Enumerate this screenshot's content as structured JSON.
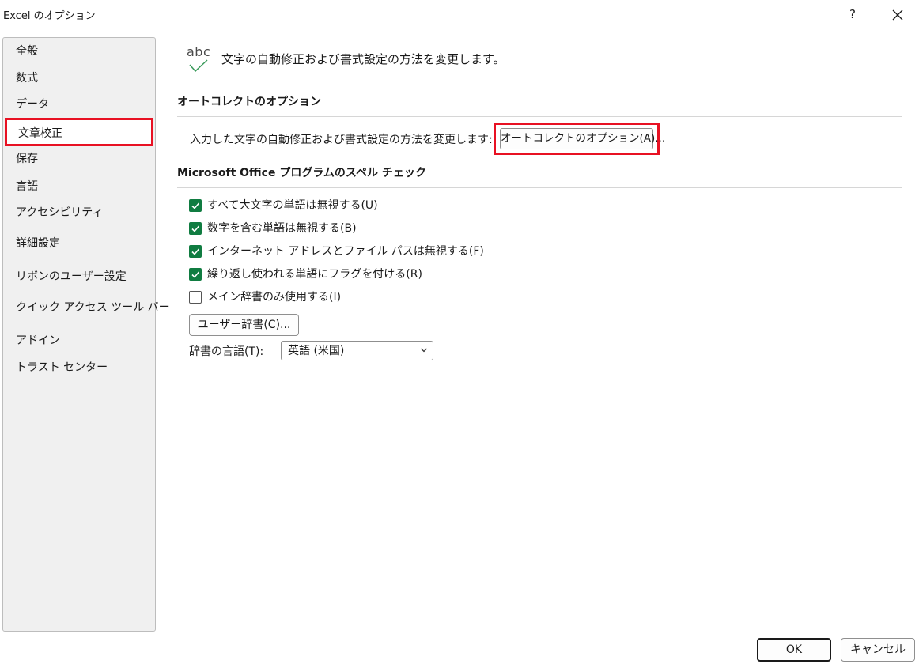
{
  "window": {
    "title": "Excel のオプション",
    "help_label": "?"
  },
  "sidebar": {
    "items": [
      {
        "label": "全般"
      },
      {
        "label": "数式"
      },
      {
        "label": "データ"
      },
      {
        "label": "文章校正",
        "selected": true
      },
      {
        "label": "保存"
      },
      {
        "label": "言語"
      },
      {
        "label": "アクセシビリティ"
      },
      {
        "label": "詳細設定"
      },
      {
        "label": "リボンのユーザー設定"
      },
      {
        "label": "クイック アクセス ツール バー"
      },
      {
        "label": "アドイン"
      },
      {
        "label": "トラスト センター"
      }
    ]
  },
  "header": {
    "icon_text": "abc",
    "description": "文字の自動修正および書式設定の方法を変更します。"
  },
  "autocorrect_section": {
    "title": "オートコレクトのオプション",
    "label": "入力した文字の自動修正および書式設定の方法を変更します:",
    "button_label": "オートコレクトのオプション(A)..."
  },
  "spelling_section": {
    "title": "Microsoft Office プログラムのスペル チェック",
    "options": [
      {
        "label": "すべて大文字の単語は無視する(U)",
        "checked": true
      },
      {
        "label": "数字を含む単語は無視する(B)",
        "checked": true
      },
      {
        "label": "インターネット アドレスとファイル パスは無視する(F)",
        "checked": true
      },
      {
        "label": "繰り返し使われる単語にフラグを付ける(R)",
        "checked": true
      },
      {
        "label": "メイン辞書のみ使用する(I)",
        "checked": false
      }
    ],
    "custom_dict_button": "ユーザー辞書(C)...",
    "dictionary_language_label": "辞書の言語(T):",
    "dictionary_language_value": "英語 (米国)"
  },
  "footer": {
    "ok_label": "OK",
    "cancel_label": "キャンセル"
  },
  "colors": {
    "accent_green": "#107c41",
    "highlight_red": "#e81123",
    "sidebar_bg": "#f0f0f0"
  }
}
